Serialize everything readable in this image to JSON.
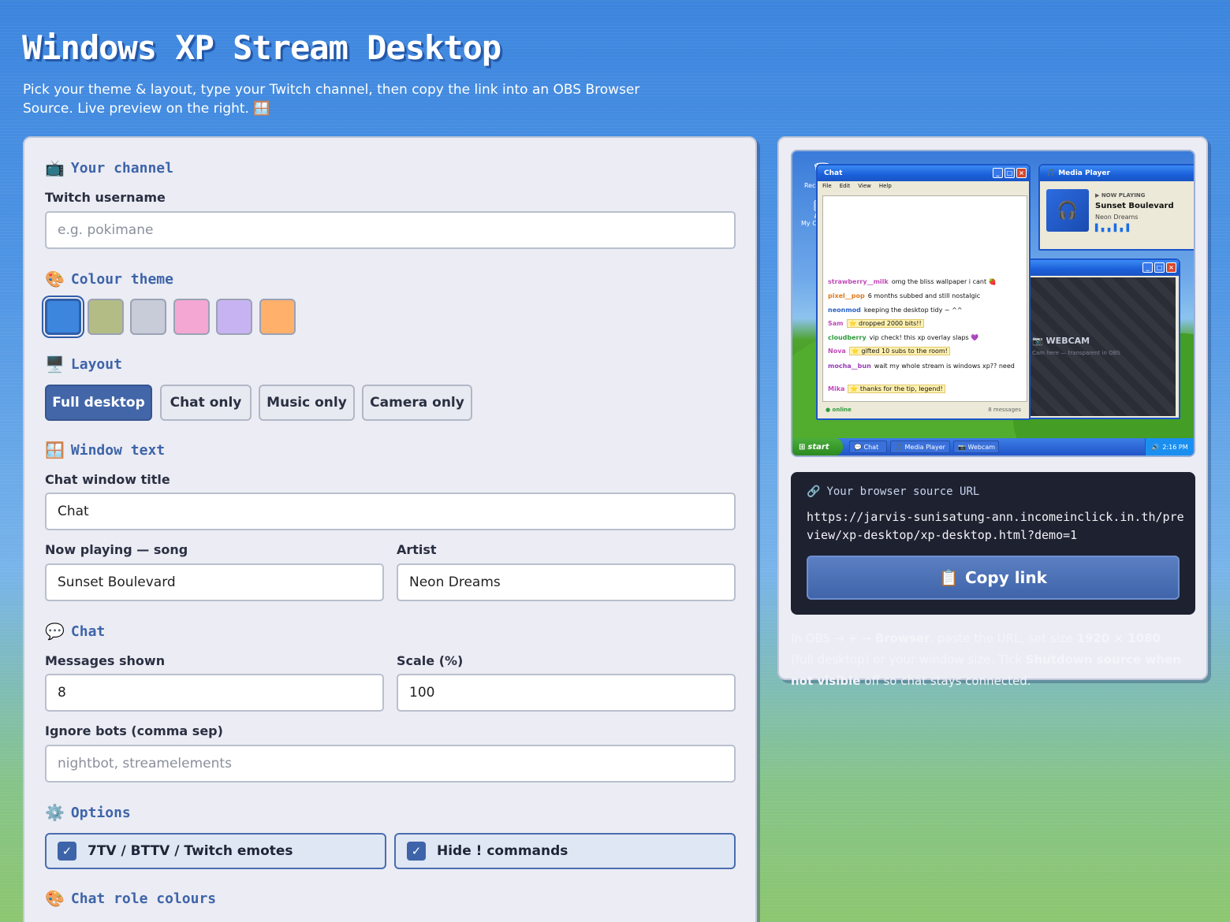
{
  "header": {
    "title": "Windows XP Stream Desktop",
    "subtitle": "Pick your theme & layout, type your Twitch channel, then copy the link into an OBS Browser Source. Live preview on the right. 🪟"
  },
  "form": {
    "channel_heading": "Your channel",
    "channel_icon": "📺",
    "username_label": "Twitch username",
    "username_placeholder": "e.g. pokimane",
    "username_value": "",
    "theme_heading": "Colour theme",
    "theme_icon": "🎨",
    "theme_swatches": [
      "#3c86de",
      "#b4bc86",
      "#c7ccd8",
      "#f5a7d4",
      "#c8b3f2",
      "#ffb06a"
    ],
    "theme_selected_index": 0,
    "layout_heading": "Layout",
    "layout_icon": "🖥️",
    "layouts": [
      "Full desktop",
      "Chat only",
      "Music only",
      "Camera only"
    ],
    "layout_selected": "Full desktop",
    "window_text_heading": "Window text",
    "window_text_icon": "🪟",
    "chat_title_label": "Chat window title",
    "chat_title_value": "Chat",
    "song_label": "Now playing — song",
    "song_value": "Sunset Boulevard",
    "artist_label": "Artist",
    "artist_value": "Neon Dreams",
    "chat_heading": "Chat",
    "chat_icon": "💬",
    "messages_label": "Messages shown",
    "messages_value": "8",
    "scale_label": "Scale (%)",
    "scale_value": "100",
    "ignore_label": "Ignore bots (comma sep)",
    "ignore_placeholder": "nightbot, streamelements",
    "options_heading": "Options",
    "options_icon": "⚙️",
    "option_emotes": "7TV / BTTV / Twitch emotes",
    "option_emotes_checked": true,
    "option_commands": "Hide ! commands",
    "option_commands_checked": true,
    "role_colours_heading": "Chat role colours",
    "role_colours_icon": "🎨"
  },
  "preview": {
    "recycle_label": "Recycle Bin",
    "mycomputer_label": "My Computer",
    "chat_window": {
      "title": "Chat",
      "menu": [
        "File",
        "Edit",
        "View",
        "Help"
      ],
      "status": "● online",
      "count": "8 messages",
      "messages": [
        {
          "user": "strawberry__milk",
          "text": "omg the bliss wallpaper i cant 🍓",
          "color": "#c04ab8",
          "highlight": false
        },
        {
          "user": "pixel__pop",
          "text": "6 months subbed and still nostalgic",
          "color": "#e07a1a",
          "highlight": false
        },
        {
          "user": "neonmod",
          "text": "keeping the desktop tidy ~ ^^",
          "color": "#2a62c8",
          "highlight": false
        },
        {
          "user": "Sam",
          "text": "⭐ dropped 2000 bits!!",
          "color": "#c04ab8",
          "highlight": true
        },
        {
          "user": "cloudberry",
          "text": "vip check! this xp overlay slaps 💜",
          "color": "#2e9a3c",
          "highlight": false
        },
        {
          "user": "Nova",
          "text": "⭐ gifted 10 subs to the room!",
          "color": "#c04ab8",
          "highlight": true
        },
        {
          "user": "mocha__bun",
          "text": "wait my whole stream is windows xp?? need",
          "color": "#9a3ab8",
          "highlight": false
        },
        {
          "user": "Mika",
          "text": "⭐ thanks for the tip, legend!",
          "color": "#c04ab8",
          "highlight": true
        }
      ]
    },
    "media_window": {
      "title": "Media Player",
      "now_playing": "▶ NOW PLAYING",
      "song": "Sunset Boulevard",
      "artist": "Neon Dreams"
    },
    "webcam_window": {
      "label": "WEBCAM",
      "sub": "Cam here — transparent in OBS"
    },
    "taskbar": {
      "start": "start",
      "items": [
        "💬 Chat",
        "🎵 Media Player",
        "📷 Webcam"
      ],
      "time": "2:16 PM"
    }
  },
  "url_box": {
    "heading": "Your browser source URL",
    "url": "https://jarvis-sunisatung-ann.incomeinclick.in.th/preview/xp-desktop/xp-desktop.html?demo=1",
    "copy_label": "Copy link",
    "copy_icon": "📋"
  },
  "obs_note": {
    "text1": "In OBS → + → ",
    "bold1": "Browser",
    "text2": ", paste the URL, set size ",
    "bold2": "1920 × 1080",
    "text3": " (full desktop) or your window size. Tick ",
    "bold3": "Shutdown source when not visible",
    "text4": " off so chat stays connected."
  },
  "colors": {
    "accent": "#3d64a9",
    "panel_bg": "#ececf4",
    "url_bg": "#1e2130"
  }
}
